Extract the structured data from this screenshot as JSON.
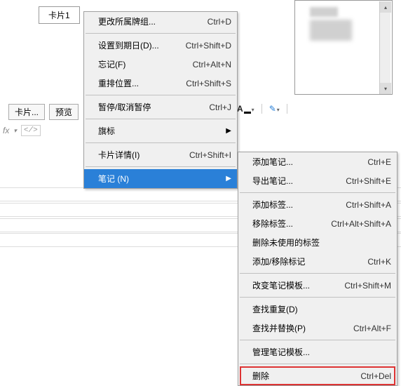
{
  "tab_label": "卡片1",
  "toolbar": {
    "cards_label": "卡片...",
    "preview_label": "预览"
  },
  "fx_label": "fx",
  "menu1": {
    "items": [
      {
        "label": "更改所属牌组...",
        "shortcut": "Ctrl+D"
      },
      {
        "label": "设置到期日(D)...",
        "shortcut": "Ctrl+Shift+D"
      },
      {
        "label": "忘记(F)",
        "shortcut": "Ctrl+Alt+N"
      },
      {
        "label": "重排位置...",
        "shortcut": "Ctrl+Shift+S"
      },
      {
        "label": "暂停/取消暂停",
        "shortcut": "Ctrl+J"
      },
      {
        "label": "旗标",
        "submenu": true
      },
      {
        "label": "卡片详情(I)",
        "shortcut": "Ctrl+Shift+I"
      },
      {
        "label": "笔记 (N)",
        "submenu": true,
        "highlight": true
      }
    ]
  },
  "menu2": {
    "items": [
      {
        "label": "添加笔记...",
        "shortcut": "Ctrl+E"
      },
      {
        "label": "导出笔记...",
        "shortcut": "Ctrl+Shift+E"
      },
      {
        "label": "添加标签...",
        "shortcut": "Ctrl+Shift+A"
      },
      {
        "label": "移除标签...",
        "shortcut": "Ctrl+Alt+Shift+A"
      },
      {
        "label": "删除未使用的标签"
      },
      {
        "label": "添加/移除标记",
        "shortcut": "Ctrl+K"
      },
      {
        "label": "改变笔记模板...",
        "shortcut": "Ctrl+Shift+M"
      },
      {
        "label": "查找重复(D)"
      },
      {
        "label": "查找并替换(P)",
        "shortcut": "Ctrl+Alt+F"
      },
      {
        "label": "管理笔记模板..."
      },
      {
        "label": "删除",
        "shortcut": "Ctrl+Del",
        "boxed": true
      }
    ]
  }
}
